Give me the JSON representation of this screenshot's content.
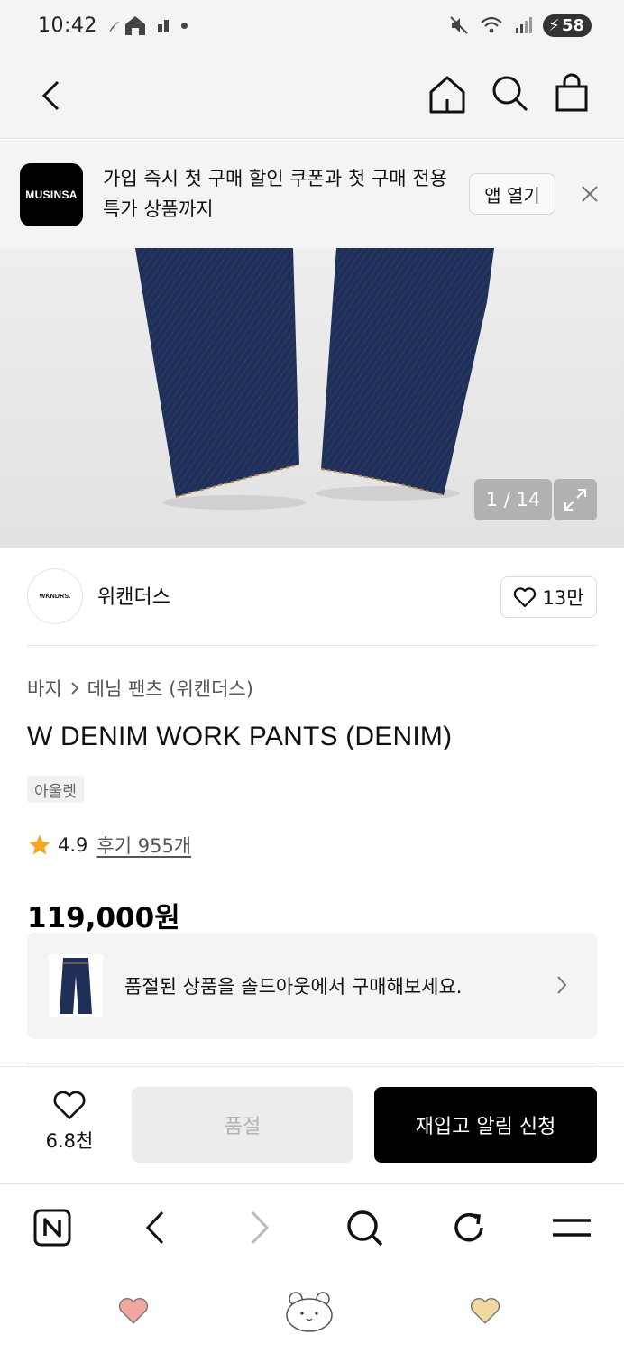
{
  "status_bar": {
    "time": "10:42",
    "battery": "58"
  },
  "top_nav": {
    "icons": [
      "back-icon",
      "home-icon",
      "search-icon",
      "shopping-bag-icon"
    ]
  },
  "app_banner": {
    "logo_text": "MUSINSA",
    "message": "가입 즉시 첫 구매 할인 쿠폰과 첫 구매 전용 특가 상품까지",
    "open_button": "앱 열기"
  },
  "gallery": {
    "counter": "1 / 14"
  },
  "brand": {
    "logo_text": "WKNDRS.",
    "name": "위캔더스",
    "likes": "13만"
  },
  "product": {
    "breadcrumb": [
      "바지",
      "데님 팬츠 (위캔더스)"
    ],
    "title": "W DENIM WORK PANTS (DENIM)",
    "tag": "아울렛",
    "rating": "4.9",
    "review_link": "후기 955개",
    "price": "119,000원"
  },
  "soldout_card": {
    "text": "품절된 상품을 솔드아웃에서 구매해보세요."
  },
  "bottom_bar": {
    "wish_count": "6.8천",
    "soldout_label": "품절",
    "restock_label": "재입고 알림 신청"
  },
  "colors": {
    "accent_star": "#F5A623",
    "primary_button": "#000000",
    "disabled_button": "#ECECEC",
    "denim": "#1f2f57"
  }
}
